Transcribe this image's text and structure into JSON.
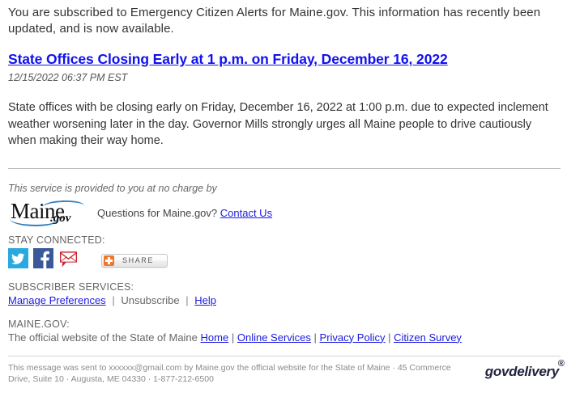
{
  "alert": {
    "intro": "You are subscribed to Emergency Citizen Alerts for Maine.gov. This information has recently been updated, and is now available.",
    "title": "State Offices Closing Early at 1 p.m. on Friday, December 16, 2022",
    "timestamp": "12/15/2022 06:37 PM EST",
    "body": "State offices with be closing early on Friday, December 16, 2022 at 1:00 p.m. due to expected inclement weather worsening later in the day. Governor Mills strongly urges all Maine people to drive cautiously when making their way home.",
    "title_color": "#1111ee"
  },
  "footer": {
    "no_charge_text": "This service is provided to you at no charge by",
    "logo": {
      "name": "maine-gov-logo",
      "word": "Maine",
      "suffix": ".gov",
      "swoosh_color": "#2f7fc1"
    },
    "questions_text": "Questions for Maine.gov?",
    "contact_us_label": "Contact Us",
    "stay_connected_label": "STAY CONNECTED:",
    "social": [
      {
        "icon": "twitter-icon",
        "label": "Twitter",
        "color": "#29a9e0"
      },
      {
        "icon": "facebook-icon",
        "label": "Facebook",
        "color": "#3b5998"
      },
      {
        "icon": "email-icon",
        "label": "Email",
        "color": "#c8242b"
      }
    ],
    "share": {
      "label": "SHARE",
      "icon": "share-plus-icon",
      "accent": "#f2762a"
    },
    "subscriber_services": {
      "label": "SUBSCRIBER SERVICES:",
      "items": [
        {
          "label": "Manage Preferences",
          "link": true
        },
        {
          "label": "Unsubscribe",
          "link": false
        },
        {
          "label": "Help",
          "link": true
        }
      ],
      "separator": "|"
    },
    "mainegov": {
      "label": "MAINE.GOV:",
      "official_text": "The official website of the State of Maine",
      "links": [
        {
          "label": "Home"
        },
        {
          "label": "Online Services"
        },
        {
          "label": "Privacy Policy"
        },
        {
          "label": "Citizen Survey"
        }
      ],
      "separator": "|"
    },
    "disclaimer": "This message was sent to xxxxxx@gmail.com by Maine.gov the official website for the State of Maine · 45 Commerce Drive, Suite 10 · Augusta, ME 04330 · 1-877-212-6500",
    "govdelivery": {
      "word": "govdelivery",
      "mark": "®"
    }
  }
}
